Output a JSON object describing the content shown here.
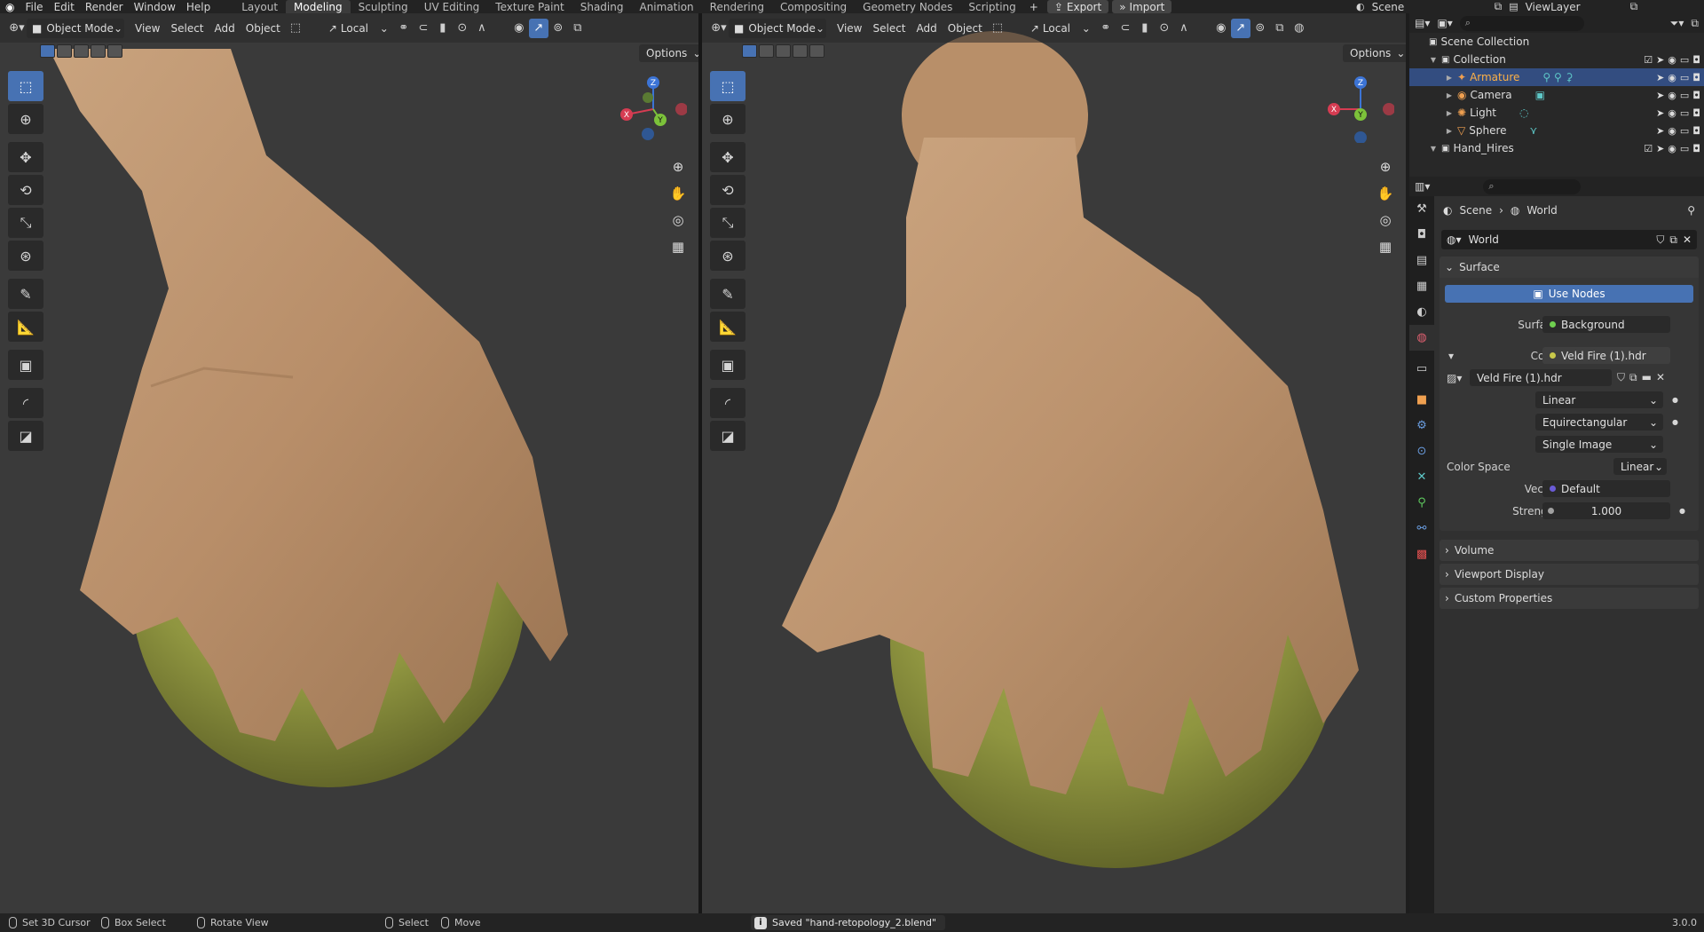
{
  "app": {
    "logo_icon": "blender-logo-icon"
  },
  "menu": [
    "File",
    "Edit",
    "Render",
    "Window",
    "Help"
  ],
  "workspaces": {
    "tabs": [
      "Layout",
      "Modeling",
      "Sculpting",
      "UV Editing",
      "Texture Paint",
      "Shading",
      "Animation",
      "Rendering",
      "Compositing",
      "Geometry Nodes",
      "Scripting"
    ],
    "active": "Modeling"
  },
  "top_actions": {
    "export": "Export",
    "import": "Import"
  },
  "scene_selector": {
    "value": "Scene"
  },
  "view_layer": {
    "value": "ViewLayer"
  },
  "viewport_header": {
    "mode": "Object Mode",
    "menus": [
      "View",
      "Select",
      "Add",
      "Object"
    ],
    "orientation": "Local",
    "options": "Options"
  },
  "gizmo": {
    "x": "X",
    "y": "Y",
    "z": "Z"
  },
  "outliner": {
    "root": "Scene Collection",
    "rows": [
      {
        "label": "Collection",
        "depth": 1,
        "icon": "collection-icon"
      },
      {
        "label": "Armature",
        "depth": 2,
        "icon": "armature-icon",
        "selected": true
      },
      {
        "label": "Camera",
        "depth": 2,
        "icon": "camera-icon"
      },
      {
        "label": "Light",
        "depth": 2,
        "icon": "light-icon"
      },
      {
        "label": "Sphere",
        "depth": 2,
        "icon": "mesh-icon"
      },
      {
        "label": "Hand_Hires",
        "depth": 1,
        "icon": "collection-icon"
      }
    ]
  },
  "properties": {
    "breadcrumb": {
      "scene": "Scene",
      "world": "World"
    },
    "world_name": "World",
    "surface_panel": "Surface",
    "use_nodes": "Use Nodes",
    "fields": {
      "surface_label": "Surface",
      "surface_value": "Background",
      "color_label": "Color",
      "color_value": "Veld Fire (1).hdr",
      "image_name": "Veld Fire (1).hdr",
      "interpolation": "Linear",
      "projection": "Equirectangular",
      "source": "Single Image",
      "color_space_label": "Color Space",
      "color_space_value": "Linear",
      "vector_label": "Vector",
      "vector_value": "Default",
      "strength_label": "Strength",
      "strength_value": "1.000"
    },
    "collapsed_panels": [
      "Volume",
      "Viewport Display",
      "Custom Properties"
    ]
  },
  "status": {
    "set_cursor": "Set 3D Cursor",
    "box_select": "Box Select",
    "rotate_view": "Rotate View",
    "select": "Select",
    "move": "Move",
    "saved_message": "Saved \"hand-retopology_2.blend\"",
    "version": "3.0.0"
  },
  "colors": {
    "accent": "#4772b3",
    "selected_text": "#fcb046",
    "sphere": "#8f9540",
    "skin": "#c6a07b",
    "background": "#3a3a3a"
  }
}
